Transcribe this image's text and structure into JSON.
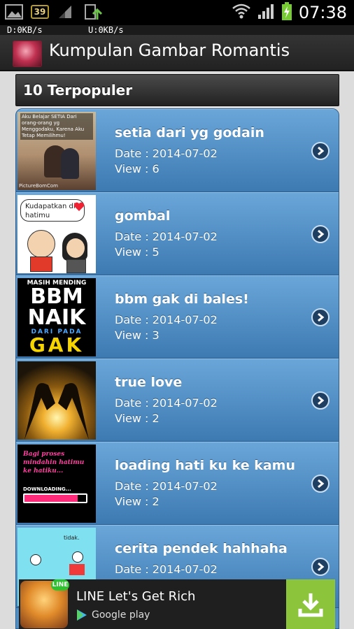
{
  "status_bar": {
    "notification_count": "39",
    "time": "07:38",
    "download_speed": "D:0KB/s",
    "upload_speed": "U:0KB/s"
  },
  "app": {
    "title": "Kumpulan Gambar Romantis"
  },
  "section": {
    "title": "10 Terpopuler"
  },
  "items": [
    {
      "title": "setia dari yg godain",
      "date": "Date : 2014-07-02",
      "views": "View : 6"
    },
    {
      "title": "gombal",
      "date": "Date : 2014-07-02",
      "views": "View : 5"
    },
    {
      "title": "bbm gak di bales!",
      "date": "Date : 2014-07-02",
      "views": "View : 3"
    },
    {
      "title": "true love",
      "date": "Date : 2014-07-02",
      "views": "View : 2"
    },
    {
      "title": "loading hati ku ke kamu",
      "date": "Date : 2014-07-02",
      "views": "View : 2"
    },
    {
      "title": "cerita pendek hahhaha",
      "date": "Date : 2014-07-02",
      "views": ""
    }
  ],
  "thumbnails": {
    "t1_text": "Aku Belajar SETIA Dari orang-orang yg Menggodaku, Karena Aku Tetap Memilihmu!",
    "t1_credit": "PictureBomCom",
    "t2_text": "Kudapatkan di hatimu",
    "t3_top": "MASIH MENDING",
    "t3_big1": "BBM",
    "t3_big2": "NAIK",
    "t3_mid": "DARI PADA",
    "t3_big3": "GAK",
    "t5_text": "Bagi proses mindahin hatimu ke hatiku...",
    "t5_loading": "DOWNLOADING...",
    "t6_text": "tidak."
  },
  "ad": {
    "title": "LINE Let's Get Rich",
    "store": "Google play",
    "badge": "LINE"
  }
}
